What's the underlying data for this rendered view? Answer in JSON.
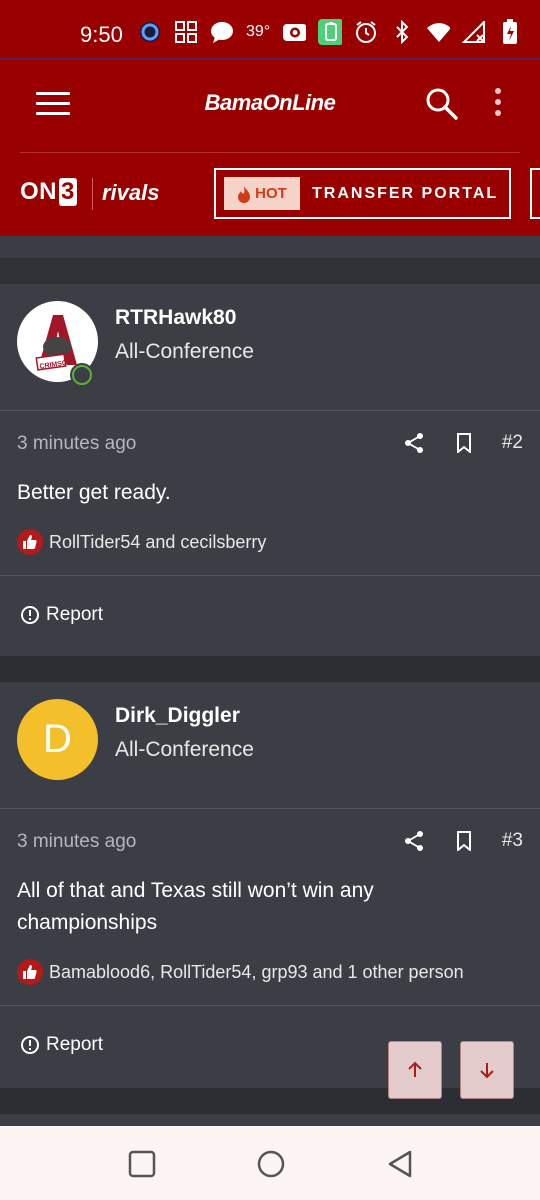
{
  "status_bar": {
    "time": "9:50",
    "temperature": "39°",
    "icons": [
      "ring-icon",
      "apps-icon",
      "chat-icon",
      "temperature",
      "camera-icon",
      "battery-saver-icon",
      "alarm-icon",
      "bluetooth-icon",
      "wifi-icon",
      "signal-icon",
      "battery-icon"
    ]
  },
  "header": {
    "site_name": "BamaOnLine",
    "on3_label_a": "ON",
    "on3_label_b": "3",
    "rivals_label": "rivals",
    "hot_label": "HOT",
    "portal_label": "TRANSFER PORTAL",
    "accent_color": "#990000"
  },
  "posts": [
    {
      "username": "RTRHawk80",
      "user_title": "All-Conference",
      "avatar_text": "CRIMSON",
      "time": "3 minutes ago",
      "post_number": "#2",
      "text": "Better get ready.",
      "reactions": "RollTider54 and cecilsberry",
      "report_label": "Report"
    },
    {
      "username": "Dirk_Diggler",
      "user_title": "All-Conference",
      "avatar_letter": "D",
      "time": "3 minutes ago",
      "post_number": "#3",
      "text": "All of that and Texas still won’t win any championships",
      "reactions": "Bamablood6, RollTider54, grp93 and 1 other person",
      "report_label": "Report"
    }
  ],
  "colors": {
    "page_bg": "#2b2e33",
    "post_bg": "#3b3f45",
    "avatar_d": "#f3c02b",
    "like": "#b31b1b",
    "online": "#5fb135"
  }
}
